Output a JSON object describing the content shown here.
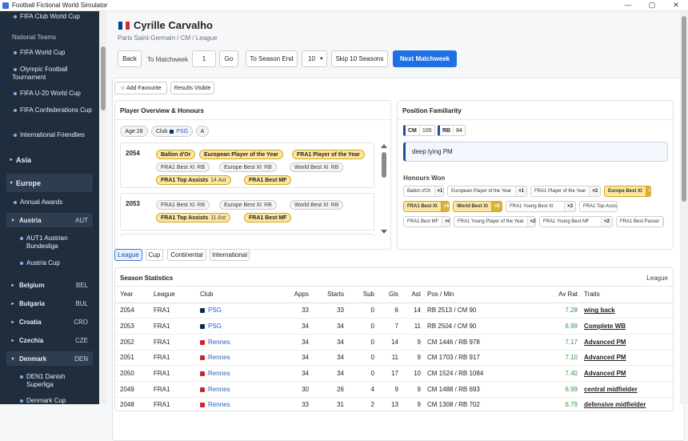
{
  "window": {
    "title": "Football Fictional World Simulator",
    "minimize": "—",
    "maximize": "▢",
    "close": "✕"
  },
  "sidebar": {
    "top_items": [
      {
        "label": "FIFA Club World Cup"
      }
    ],
    "section_national": "National Teams",
    "national": [
      {
        "label": "FIFA World Cup"
      },
      {
        "label": "Olympic Football Tournament"
      },
      {
        "label": "FIFA U-20 World Cup"
      },
      {
        "label": "FIFA Confederations Cup"
      },
      {
        "label": "International Friendlies"
      }
    ],
    "regions": [
      {
        "label": "Asia",
        "caret": "▸"
      },
      {
        "label": "Europe",
        "caret": "▾"
      }
    ],
    "europe_items": [
      {
        "label": "Annual Awards"
      }
    ],
    "countries": [
      {
        "label": "Austria",
        "code": "AUT",
        "caret": "▾"
      },
      {
        "label": "Belgium",
        "code": "BEL",
        "caret": "▸"
      },
      {
        "label": "Bulgaria",
        "code": "BUL",
        "caret": "▸"
      },
      {
        "label": "Croatia",
        "code": "CRO",
        "caret": "▸"
      },
      {
        "label": "Czechia",
        "code": "CZE",
        "caret": "▸"
      },
      {
        "label": "Denmark",
        "code": "DEN",
        "caret": "▾"
      }
    ],
    "austria_items": [
      {
        "label": "AUT1 Austrian Bundesliga"
      },
      {
        "label": "Austria Cup"
      }
    ],
    "denmark_items": [
      {
        "label": "DEN1 Danish Superliga"
      },
      {
        "label": "Denmark Cup"
      }
    ]
  },
  "player": {
    "name": "Cyrille Carvalho",
    "subtitle": "Paris Saint-Germain / CM / League",
    "flag_colors": [
      "#0a3d91",
      "#ffffff",
      "#e1262d"
    ]
  },
  "nav": {
    "back": "Back",
    "to_matchweek": "To Matchweek",
    "matchweek_value": "1",
    "go": "Go",
    "to_season_end": "To Season End",
    "seasons_select": "10",
    "skip": "Skip 10 Seasons",
    "next": "Next Matchweek"
  },
  "actions": {
    "add_favourite": "☆ Add Favourite",
    "results_visible": "Results Visible"
  },
  "overview": {
    "title": "Player Overview & Honours",
    "age": "Age 28",
    "club_label": "Club",
    "club": "PSG",
    "club_color": "#0b2d5c",
    "grade": "A",
    "seasons": [
      {
        "year": "2054",
        "rows": [
          [
            {
              "t": "Ballon d'Or",
              "gold": true
            },
            {
              "t": "European Player of the Year",
              "gold": true
            },
            {
              "t": "FRA1 Player of the Year",
              "gold": true
            }
          ],
          [
            {
              "t": "FRA1 Best XI",
              "x": "RB"
            },
            {
              "t": "Europe Best XI",
              "x": "RB"
            },
            {
              "t": "World Best XI",
              "x": "RB"
            }
          ],
          [
            {
              "t": "FRA1 Top Assists",
              "x": "14 Ast",
              "gold": true
            },
            {
              "t": "FRA1 Best MF",
              "gold": true
            }
          ]
        ]
      },
      {
        "year": "2053",
        "rows": [
          [
            {
              "t": "FRA1 Best XI",
              "x": "RB"
            },
            {
              "t": "Europe Best XI",
              "x": "RB"
            },
            {
              "t": "World Best XI",
              "x": "RB"
            }
          ],
          [
            {
              "t": "FRA1 Top Assists",
              "x": "11 Ast",
              "gold": true
            },
            {
              "t": "FRA1 Best MF",
              "gold": true
            }
          ]
        ]
      }
    ]
  },
  "familiarity": {
    "title": "Position Familiarity",
    "positions": [
      {
        "pos": "CM",
        "val": "100"
      },
      {
        "pos": "RB",
        "val": "84"
      }
    ],
    "role": "deep lying PM",
    "honours_title": "Honours Won",
    "honours": [
      [
        {
          "n": "Ballon d'Or",
          "c": "×1"
        },
        {
          "n": "European Player of the Year",
          "c": "×1"
        },
        {
          "n": "FRA1 Player of the Year",
          "c": "×2"
        },
        {
          "n": "Europe Best XI",
          "c": "×6",
          "gold": true
        }
      ],
      [
        {
          "n": "FRA1 Best XI",
          "c": "×6",
          "gold": true
        },
        {
          "n": "World Best XI",
          "c": "×6",
          "gold": true
        },
        {
          "n": "FRA1 Young Best XI",
          "c": "×3"
        },
        {
          "n": "FRA1 Top Assists",
          "c": "×3"
        }
      ],
      [
        {
          "n": "FRA1 Best MF",
          "c": "×4"
        },
        {
          "n": "FRA1 Young Player of the Year",
          "c": "×2"
        },
        {
          "n": "FRA1 Young Best MF",
          "c": "×2"
        },
        {
          "n": "FRA1 Best Passer",
          "c": "×1"
        }
      ]
    ]
  },
  "tabs": [
    {
      "label": "League",
      "active": true
    },
    {
      "label": "Cup"
    },
    {
      "label": "Continental"
    },
    {
      "label": "International"
    }
  ],
  "stats": {
    "title": "Season Statistics",
    "scope": "League",
    "columns": [
      "Year",
      "League",
      "Club",
      "Apps",
      "Starts",
      "Sub",
      "Gls",
      "Ast",
      "Pos / Min",
      "Av Rat",
      "Traits"
    ],
    "rows": [
      {
        "year": "2054",
        "league": "FRA1",
        "club": "PSG",
        "club_color": "#0b2d5c",
        "apps": "33",
        "starts": "33",
        "sub": "0",
        "gls": "6",
        "ast": "14",
        "pos": "RB 2513 / CM 90",
        "rat": "7.28",
        "trait": "wing back"
      },
      {
        "year": "2053",
        "league": "FRA1",
        "club": "PSG",
        "club_color": "#0b2d5c",
        "apps": "34",
        "starts": "34",
        "sub": "0",
        "gls": "7",
        "ast": "11",
        "pos": "RB 2504 / CM 90",
        "rat": "6.99",
        "trait": "Complete WB"
      },
      {
        "year": "2052",
        "league": "FRA1",
        "club": "Rennes",
        "club_color": "#d3242b",
        "apps": "34",
        "starts": "34",
        "sub": "0",
        "gls": "14",
        "ast": "9",
        "pos": "CM 1446 / RB 978",
        "rat": "7.17",
        "trait": "Advanced PM"
      },
      {
        "year": "2051",
        "league": "FRA1",
        "club": "Rennes",
        "club_color": "#d3242b",
        "apps": "34",
        "starts": "34",
        "sub": "0",
        "gls": "11",
        "ast": "9",
        "pos": "CM 1703 / RB 917",
        "rat": "7.10",
        "trait": "Advanced PM"
      },
      {
        "year": "2050",
        "league": "FRA1",
        "club": "Rennes",
        "club_color": "#d3242b",
        "apps": "34",
        "starts": "34",
        "sub": "0",
        "gls": "17",
        "ast": "10",
        "pos": "CM 1524 / RB 1084",
        "rat": "7.40",
        "trait": "Advanced PM"
      },
      {
        "year": "2049",
        "league": "FRA1",
        "club": "Rennes",
        "club_color": "#d3242b",
        "apps": "30",
        "starts": "26",
        "sub": "4",
        "gls": "9",
        "ast": "9",
        "pos": "CM 1488 / RB 693",
        "rat": "6.99",
        "trait": "central midfielder"
      },
      {
        "year": "2048",
        "league": "FRA1",
        "club": "Rennes",
        "club_color": "#d3242b",
        "apps": "33",
        "starts": "31",
        "sub": "2",
        "gls": "13",
        "ast": "9",
        "pos": "CM 1308 / RB 702",
        "rat": "6.79",
        "trait": "defensive midfielder"
      }
    ]
  }
}
